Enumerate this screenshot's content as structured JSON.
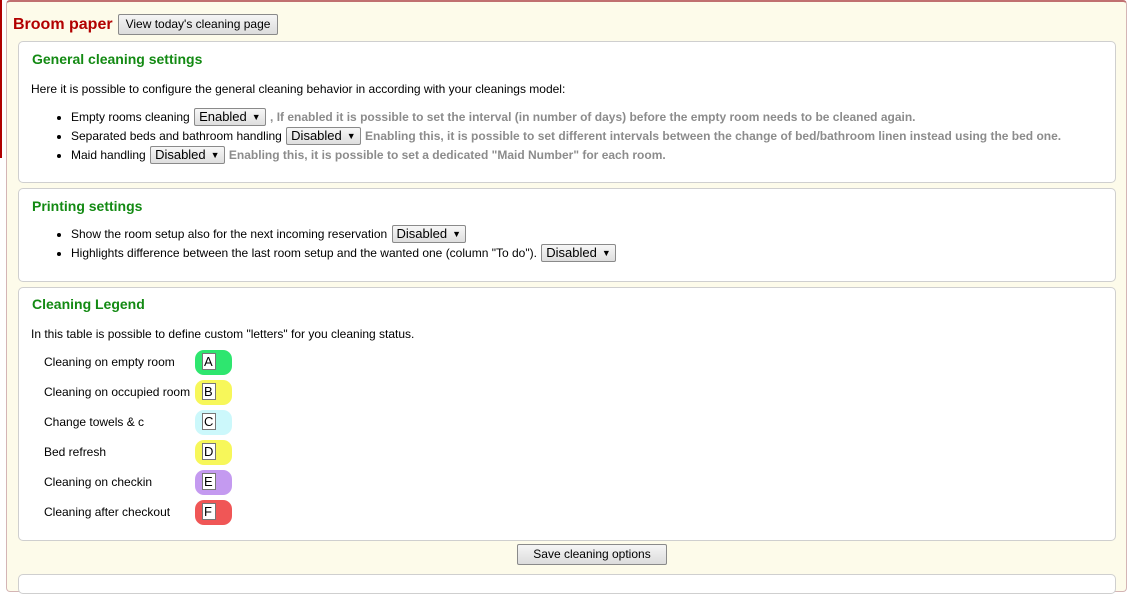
{
  "header": {
    "title": "Broom paper",
    "view_button_label": "View today's cleaning page"
  },
  "general": {
    "title": "General cleaning settings",
    "intro": "Here it is possible to configure the general cleaning behavior in according with your cleanings model:",
    "items": [
      {
        "label": "Empty rooms cleaning",
        "value": "Enabled",
        "hint": ", If enabled it is possible to set the interval (in number of days) before the empty room needs to be cleaned again."
      },
      {
        "label": "Separated beds and bathroom handling",
        "value": "Disabled",
        "hint": "Enabling this, it is possible to set different intervals between the change of bed/bathroom linen instead using the bed one."
      },
      {
        "label": "Maid handling",
        "value": "Disabled",
        "hint": "Enabling this, it is possible to set a dedicated \"Maid Number\" for each room."
      }
    ]
  },
  "printing": {
    "title": "Printing settings",
    "items": [
      {
        "label": "Show the room setup also for the next incoming reservation",
        "value": "Disabled"
      },
      {
        "label": "Highlights difference between the last room setup and the wanted one (column \"To do\").",
        "value": "Disabled"
      }
    ]
  },
  "legend": {
    "title": "Cleaning Legend",
    "intro": "In this table is possible to define custom \"letters\" for you cleaning status.",
    "rows": [
      {
        "label": "Cleaning on empty room",
        "letter": "A",
        "color": "#2ee66f"
      },
      {
        "label": "Cleaning on occupied room",
        "letter": "B",
        "color": "#f7f75a"
      },
      {
        "label": "Change towels & c",
        "letter": "C",
        "color": "#ccf8fb"
      },
      {
        "label": "Bed refresh",
        "letter": "D",
        "color": "#f7f75a"
      },
      {
        "label": "Cleaning on checkin",
        "letter": "E",
        "color": "#c49af0"
      },
      {
        "label": "Cleaning after checkout",
        "letter": "F",
        "color": "#f05656"
      }
    ]
  },
  "save_button_label": "Save cleaning options"
}
